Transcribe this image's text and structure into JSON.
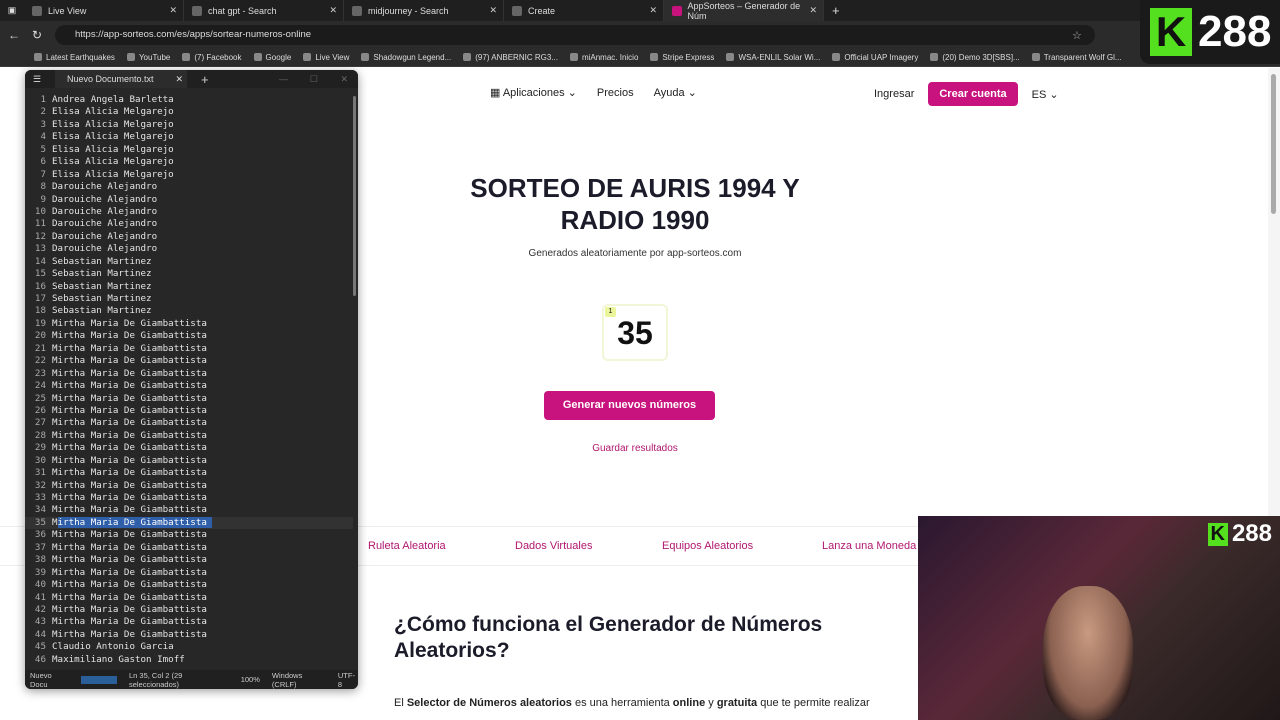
{
  "browser": {
    "tabs": [
      {
        "label": "Live View"
      },
      {
        "label": "chat gpt - Search"
      },
      {
        "label": "midjourney - Search"
      },
      {
        "label": "Create"
      },
      {
        "label": "AppSorteos – Generador de Núm"
      }
    ],
    "url": "https://app-sorteos.com/es/apps/sortear-numeros-online",
    "bookmarks": [
      "Latest Earthquakes",
      "YouTube",
      "(7) Facebook",
      "Google",
      "Live View",
      "Shadowgun Legend...",
      "(97) ANBERNIC RG3...",
      "miAnmac. Inicio",
      "Stripe Express",
      "WSA-ENLIL Solar Wi...",
      "Official UAP Imagery",
      "(20) Demo 3D[SBS]...",
      "Transparent Wolf Gl..."
    ]
  },
  "overlay": {
    "k": "K",
    "count": "288"
  },
  "site": {
    "nav": {
      "apps": "Aplicaciones",
      "prices": "Precios",
      "help": "Ayuda",
      "login": "Ingresar",
      "signup": "Crear cuenta",
      "lang": "ES"
    },
    "title": "SORTEO DE AURIS 1994 Y RADIO 1990",
    "subtitle": "Generados aleatoriamente por app-sorteos.com",
    "result": {
      "index": "1",
      "number": "35"
    },
    "generate": "Generar nuevos números",
    "save": "Guardar resultados",
    "links": [
      "Ruleta Aleatoria",
      "Dados Virtuales",
      "Equipos Aleatorios",
      "Lanza una Moneda"
    ],
    "howto_title": "¿Cómo funciona el Generador de Números Aleatorios?",
    "para": {
      "p1": "El ",
      "b1": "Selector de Números aleatorios",
      "p2": " es una herramienta ",
      "b2": "online",
      "p3": " y ",
      "b3": "gratuita",
      "p4": " que te permite realizar"
    }
  },
  "notepad": {
    "tab_title": "Nuevo Documento.txt",
    "lines": [
      "Andrea Angela Barletta",
      "Elisa Alicia Melgarejo",
      "Elisa Alicia Melgarejo",
      "Elisa Alicia Melgarejo",
      "Elisa Alicia Melgarejo",
      "Elisa Alicia Melgarejo",
      "Elisa Alicia Melgarejo",
      "Darouiche Alejandro",
      "Darouiche Alejandro",
      "Darouiche Alejandro",
      "Darouiche Alejandro",
      "Darouiche Alejandro",
      "Darouiche Alejandro",
      "Sebastian Martinez",
      "Sebastian Martinez",
      "Sebastian Martinez",
      "Sebastian Martinez",
      "Sebastian Martinez",
      "Mirtha Maria De Giambattista",
      "Mirtha Maria De Giambattista",
      "Mirtha Maria De Giambattista",
      "Mirtha Maria De Giambattista",
      "Mirtha Maria De Giambattista",
      "Mirtha Maria De Giambattista",
      "Mirtha Maria De Giambattista",
      "Mirtha Maria De Giambattista",
      "Mirtha Maria De Giambattista",
      "Mirtha Maria De Giambattista",
      "Mirtha Maria De Giambattista",
      "Mirtha Maria De Giambattista",
      "Mirtha Maria De Giambattista",
      "Mirtha Maria De Giambattista",
      "Mirtha Maria De Giambattista",
      "Mirtha Maria De Giambattista",
      "Mirtha Maria De Giambattista",
      "Mirtha Maria De Giambattista",
      "Mirtha Maria De Giambattista",
      "Mirtha Maria De Giambattista",
      "Mirtha Maria De Giambattista",
      "Mirtha Maria De Giambattista",
      "Mirtha Maria De Giambattista",
      "Mirtha Maria De Giambattista",
      "Mirtha Maria De Giambattista",
      "Mirtha Maria De Giambattista",
      "Claudio Antonio Garcia",
      "Maximiliano Gaston Imoff"
    ],
    "selected_line": 35,
    "status": {
      "name": "Nuevo Docu",
      "pos": "Ln 35, Col 2 (29 seleccionados)",
      "zoom": "100%",
      "eol": "Windows (CRLF)",
      "enc": "UTF-8"
    }
  }
}
